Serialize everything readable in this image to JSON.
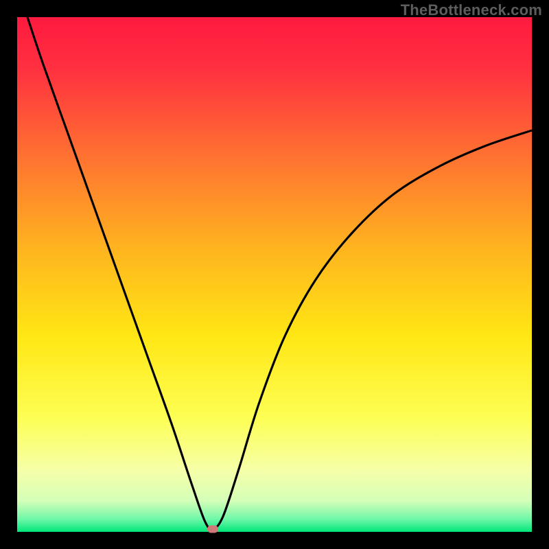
{
  "watermark": "TheBottleneck.com",
  "chart_data": {
    "type": "line",
    "title": "",
    "xlabel": "",
    "ylabel": "",
    "xlim": [
      0,
      100
    ],
    "ylim": [
      0,
      100
    ],
    "background_gradient": {
      "stops": [
        {
          "pos": 0.0,
          "color": "#ff1a3f"
        },
        {
          "pos": 0.1,
          "color": "#ff3040"
        },
        {
          "pos": 0.25,
          "color": "#ff6a33"
        },
        {
          "pos": 0.45,
          "color": "#ffb41f"
        },
        {
          "pos": 0.62,
          "color": "#ffe714"
        },
        {
          "pos": 0.78,
          "color": "#fdff55"
        },
        {
          "pos": 0.88,
          "color": "#f6ffa8"
        },
        {
          "pos": 0.94,
          "color": "#d4ffb8"
        },
        {
          "pos": 0.975,
          "color": "#70f7a8"
        },
        {
          "pos": 1.0,
          "color": "#00e67a"
        }
      ]
    },
    "series": [
      {
        "name": "bottleneck-curve",
        "color": "#000000",
        "x": [
          2,
          5,
          10,
          15,
          20,
          25,
          30,
          34,
          36.5,
          38,
          40,
          43,
          47,
          52,
          58,
          65,
          73,
          82,
          91,
          100
        ],
        "y": [
          100,
          91,
          77,
          63,
          49,
          35,
          21,
          9,
          2,
          0.5,
          3,
          12,
          25,
          38,
          49,
          58,
          65.5,
          71,
          75,
          78
        ]
      }
    ],
    "marker": {
      "x": 38,
      "y": 0.6,
      "color": "#cf7a79"
    },
    "grid": false,
    "legend": false
  }
}
